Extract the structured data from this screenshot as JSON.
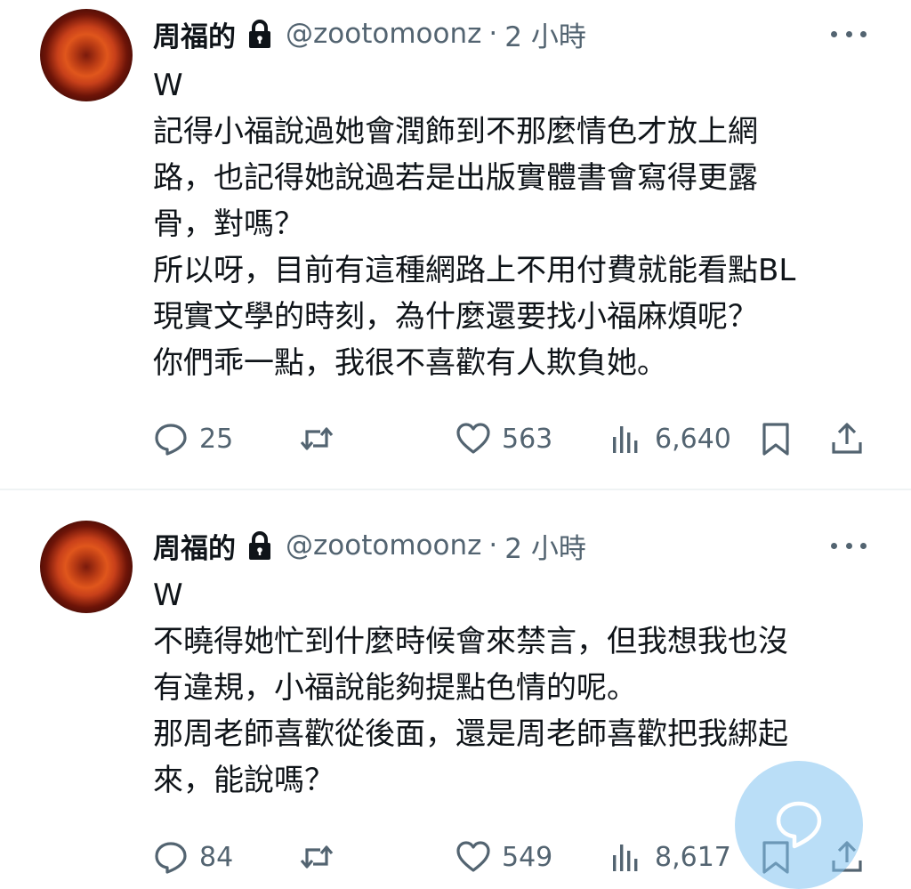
{
  "tweets": [
    {
      "author_name": "周福的",
      "handle": "@zootomoonz",
      "separator": "·",
      "time": "2 小時",
      "text_lines": [
        "W",
        "記得小福說過她會潤飾到不那麼情色才放上網",
        "路，也記得她說過若是出版實體書會寫得更露",
        "骨，對嗎？",
        "所以呀，目前有這種網路上不用付費就能看點BL",
        "現實文學的時刻，為什麼還要找小福麻煩呢？",
        "你們乖一點，我很不喜歡有人欺負她。"
      ],
      "replies": "25",
      "likes": "563",
      "views": "6,640"
    },
    {
      "author_name": "周福的",
      "handle": "@zootomoonz",
      "separator": "·",
      "time": "2 小時",
      "text_lines": [
        "W",
        "不曉得她忙到什麼時候會來禁言，但我想我也沒",
        "有違規，小福說能夠提點色情的呢。",
        "那周老師喜歡從後面，還是周老師喜歡把我綁起",
        "來，能說嗎？"
      ],
      "replies": "84",
      "likes": "549",
      "views": "8,617"
    }
  ],
  "icons": {
    "lock": "lock-icon",
    "more": "more-icon",
    "reply": "reply-icon",
    "retweet": "retweet-icon",
    "like": "heart-icon",
    "views": "views-icon",
    "bookmark": "bookmark-icon",
    "share": "share-icon",
    "compose": "compose-reply-icon"
  },
  "colors": {
    "text": "#0f1419",
    "secondary": "#536471",
    "divider": "#eff3f4",
    "fab": "#82c2f0"
  }
}
